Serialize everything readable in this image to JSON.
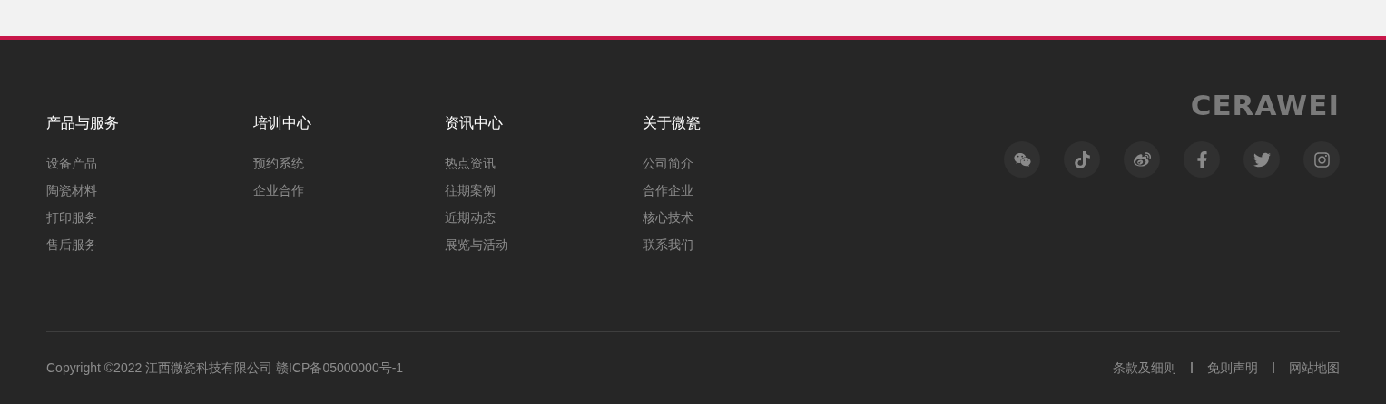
{
  "columns": [
    {
      "title": "产品与服务",
      "links": [
        "设备产品",
        "陶瓷材料",
        "打印服务",
        "售后服务"
      ]
    },
    {
      "title": "培训中心",
      "links": [
        "预约系统",
        "企业合作"
      ]
    },
    {
      "title": "资讯中心",
      "links": [
        "热点资讯",
        "往期案例",
        "近期动态",
        "展览与活动"
      ]
    },
    {
      "title": "关于微瓷",
      "links": [
        "公司简介",
        "合作企业",
        "核心技术",
        "联系我们"
      ]
    }
  ],
  "logo": "CERAWEI",
  "social": [
    {
      "kind": "wechat"
    },
    {
      "kind": "tiktok"
    },
    {
      "kind": "weibo"
    },
    {
      "kind": "facebook"
    },
    {
      "kind": "twitter"
    },
    {
      "kind": "instagram"
    }
  ],
  "copyright": "Copyright ©2022 江西微瓷科技有限公司 赣ICP备05000000号-1",
  "legal_links": [
    "条款及细则",
    "免则声明",
    "网站地图"
  ]
}
